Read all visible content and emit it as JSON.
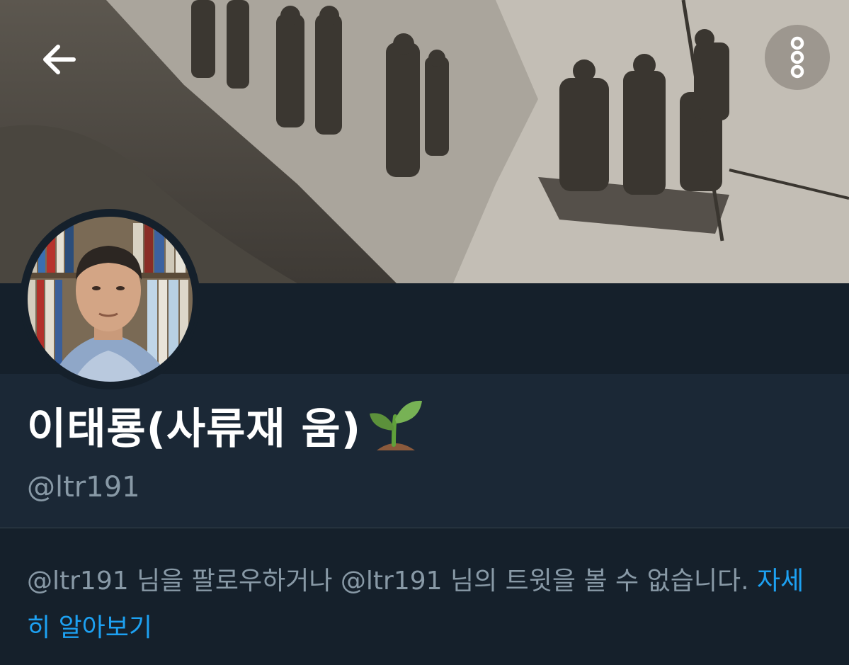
{
  "header": {
    "back_icon": "arrow-left-icon",
    "more_icon": "more-vertical-icon",
    "banner_image": "sepia historical photograph of uniformed men on a riverbank and in a boat"
  },
  "profile": {
    "avatar_image": "portrait of a man in front of bookshelves",
    "display_name": "이태룡(사류재 움)",
    "name_emoji": "seedling-icon",
    "handle": "@ltr191"
  },
  "notice": {
    "text": "@ltr191 님을 팔로우하거나 @ltr191 님의 트윗을 볼 수 없습니다.",
    "link_label": "자세히 알아보기"
  },
  "colors": {
    "background": "#15202b",
    "name_band": "#1b2836",
    "muted_text": "#8899a6",
    "link": "#1da1f2"
  }
}
